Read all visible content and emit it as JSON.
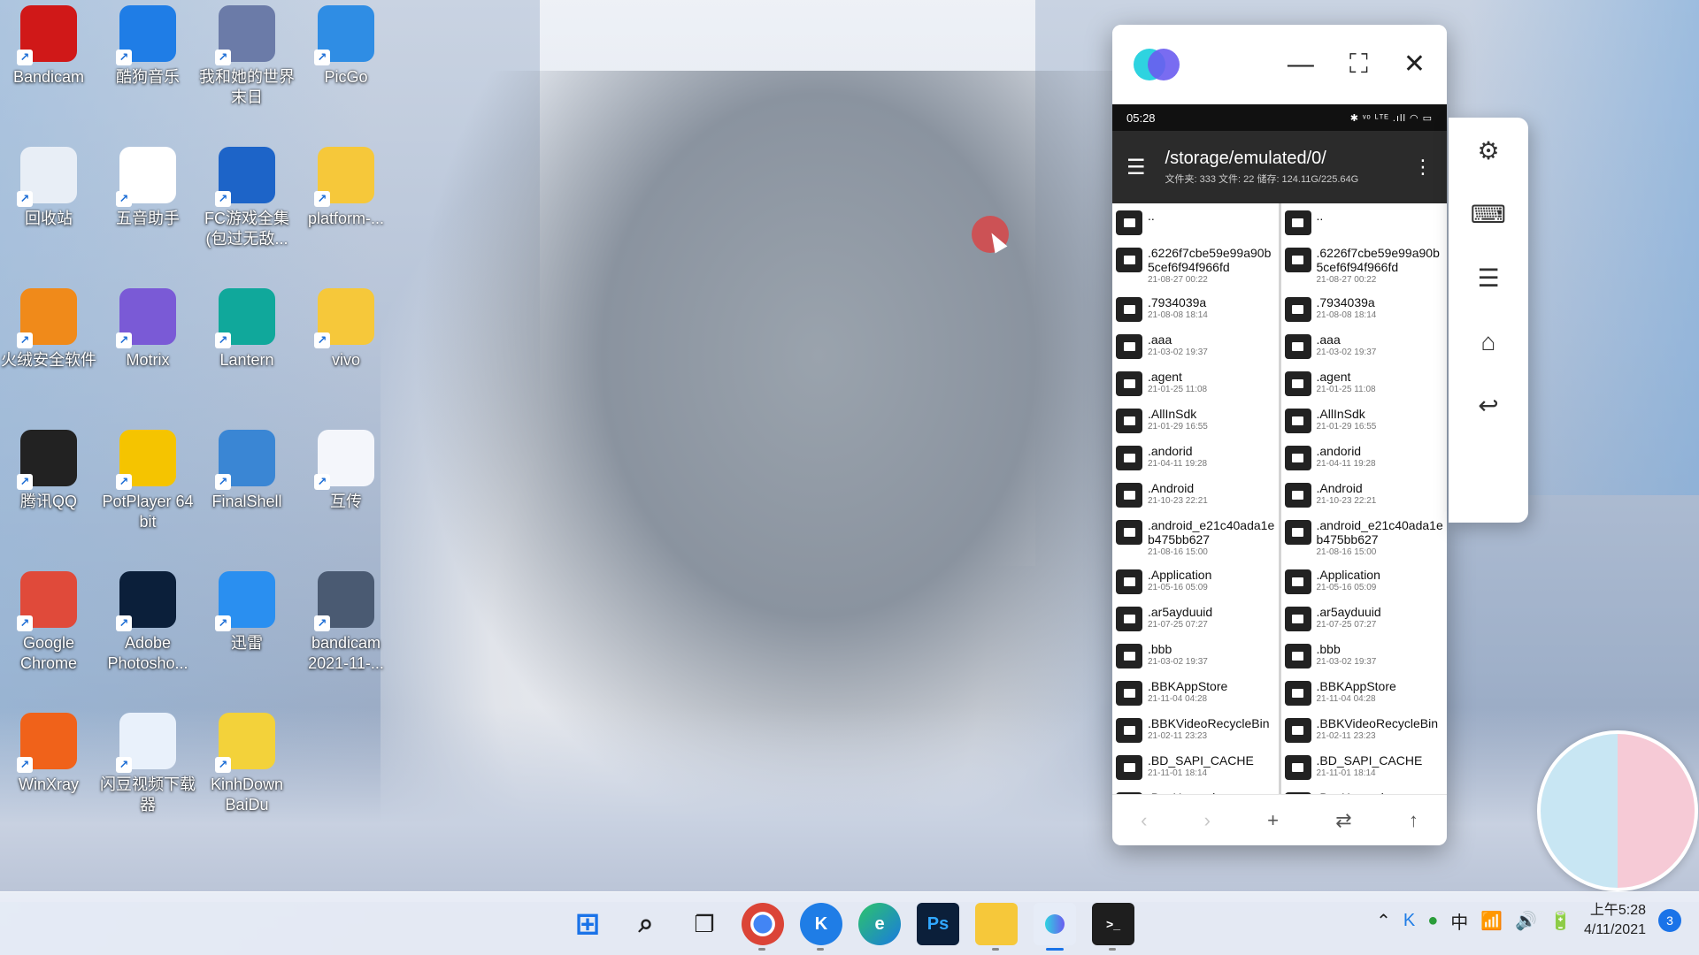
{
  "desktop": {
    "icons": [
      {
        "label": "Bandicam",
        "icon": "bandicam-icon",
        "color": "#d01818"
      },
      {
        "label": "酷狗音乐",
        "icon": "kugou-icon",
        "color": "#1f7de6"
      },
      {
        "label": "我和她的世界末日",
        "icon": "anime-game-icon",
        "color": "#6b7ba8"
      },
      {
        "label": "PicGo",
        "icon": "picgo-icon",
        "color": "#2f8de4"
      },
      {
        "label": "回收站",
        "icon": "recycle-bin-icon",
        "color": "#e8eef6"
      },
      {
        "label": "五音助手",
        "icon": "music-note-icon",
        "color": "#ffffff"
      },
      {
        "label": "FC游戏全集(包过无敌...",
        "icon": "zip-icon",
        "color": "#1d64c8"
      },
      {
        "label": "platform-...",
        "icon": "folder-icon",
        "color": "#f6c83a"
      },
      {
        "label": "火绒安全软件",
        "icon": "huorong-icon",
        "color": "#f08a1a"
      },
      {
        "label": "Motrix",
        "icon": "motrix-icon",
        "color": "#7a5ad6"
      },
      {
        "label": "Lantern",
        "icon": "lantern-icon",
        "color": "#10a89b"
      },
      {
        "label": "vivo",
        "icon": "folder-icon",
        "color": "#f6c83a"
      },
      {
        "label": "腾讯QQ",
        "icon": "qq-icon",
        "color": "#222222"
      },
      {
        "label": "PotPlayer 64 bit",
        "icon": "potplayer-icon",
        "color": "#f5c400"
      },
      {
        "label": "FinalShell",
        "icon": "finalshell-icon",
        "color": "#3a86d4"
      },
      {
        "label": "互传",
        "icon": "hu-chuan-icon",
        "color": "#f4f6fb"
      },
      {
        "label": "Google Chrome",
        "icon": "chrome-icon",
        "color": "#e04a3a"
      },
      {
        "label": "Adobe Photosho...",
        "icon": "photoshop-icon",
        "color": "#0b1f3a"
      },
      {
        "label": "迅雷",
        "icon": "xunlei-icon",
        "color": "#2a8ff0"
      },
      {
        "label": "bandicam 2021-11-...",
        "icon": "video-file-icon",
        "color": "#4a5a72"
      },
      {
        "label": "WinXray",
        "icon": "winxray-icon",
        "color": "#f0621a"
      },
      {
        "label": "闪豆视频下载器",
        "icon": "shandou-icon",
        "color": "#e9f1fb"
      },
      {
        "label": "KinhDown BaiDu",
        "icon": "kinhdown-icon",
        "color": "#f3d23a"
      }
    ]
  },
  "mirror": {
    "phone_time": "05:28",
    "phone_status_right": "✱ ᵛᵒ ᴸᵀᴱ .ıll ◠ ▭",
    "fm": {
      "path": "/storage/emulated/0/",
      "subtitle": "文件夹: 333  文件: 22  储存: 124.11G/225.64G",
      "items": [
        {
          "name": "..",
          "date": ""
        },
        {
          "name": ".6226f7cbe59e99a90b5cef6f94f966fd",
          "date": "21-08-27 00:22"
        },
        {
          "name": ".7934039a",
          "date": "21-08-08 18:14"
        },
        {
          "name": ".aaa",
          "date": "21-03-02 19:37"
        },
        {
          "name": ".agent",
          "date": "21-01-25 11:08"
        },
        {
          "name": ".AllInSdk",
          "date": "21-01-29 16:55"
        },
        {
          "name": ".andorid",
          "date": "21-04-11 19:28"
        },
        {
          "name": ".Android",
          "date": "21-10-23 22:21"
        },
        {
          "name": ".android_e21c40ada1eb475bb627",
          "date": "21-08-16 15:00"
        },
        {
          "name": ".Application",
          "date": "21-05-16 05:09"
        },
        {
          "name": ".ar5ayduuid",
          "date": "21-07-25 07:27"
        },
        {
          "name": ".bbb",
          "date": "21-03-02 19:37"
        },
        {
          "name": ".BBKAppStore",
          "date": "21-11-04 04:28"
        },
        {
          "name": ".BBKVideoRecycleBin",
          "date": "21-02-11 23:23"
        },
        {
          "name": ".BD_SAPI_CACHE",
          "date": "21-11-01 18:14"
        },
        {
          "name": ".BugXposed",
          "date": ""
        }
      ]
    }
  },
  "side_panel": {
    "icons": [
      "settings-icon",
      "keyboard-icon",
      "menu-icon",
      "home-icon",
      "back-icon"
    ]
  },
  "taskbar": {
    "clock_time": "上午5:28",
    "clock_date": "4/11/2021",
    "notification_count": "3",
    "ime": "中"
  }
}
